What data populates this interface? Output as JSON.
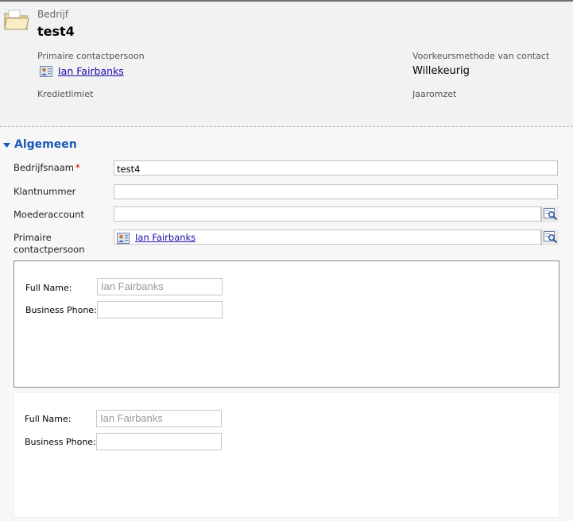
{
  "header": {
    "entity_type": "Bedrijf",
    "record_name": "test4",
    "primary_contact_label": "Primaire contactpersoon",
    "primary_contact_value": "Ian Fairbanks",
    "preferred_method_label": "Voorkeursmethode van contact",
    "preferred_method_value": "Willekeurig",
    "credit_limit_label": "Kredietlimiet",
    "annual_revenue_label": "Jaaromzet"
  },
  "section": {
    "title": "Algemeen",
    "fields": {
      "company_name": {
        "label": "Bedrijfsnaam",
        "required_marker": "*",
        "value": "test4"
      },
      "customer_number": {
        "label": "Klantnummer",
        "value": ""
      },
      "parent_account": {
        "label": "Moederaccount",
        "value": ""
      },
      "primary_contact": {
        "label_line1": "Primaire",
        "label_line2": "contactpersoon",
        "value": "Ian Fairbanks"
      }
    }
  },
  "web_resources": [
    {
      "full_name_label": "Full Name:",
      "full_name_value": "Ian Fairbanks",
      "business_phone_label": "Business Phone:",
      "business_phone_value": ""
    },
    {
      "full_name_label": "Full Name:",
      "full_name_value": "Ian Fairbanks",
      "business_phone_label": "Business Phone:",
      "business_phone_value": ""
    }
  ],
  "icons": {
    "entity": "account-folder-icon",
    "contact": "contact-card-icon",
    "lookup": "lookup-search-icon",
    "section_toggle": "collapse-triangle-icon"
  },
  "colors": {
    "section_title": "#1a5ab6",
    "link": "#1a0dab",
    "required": "#c00000"
  }
}
